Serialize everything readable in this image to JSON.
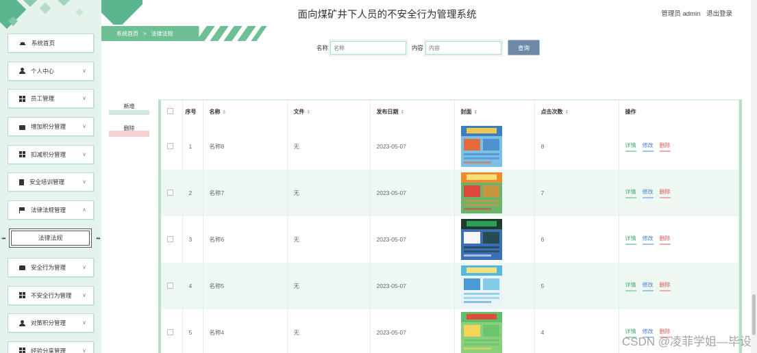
{
  "app": {
    "title": "面向煤矿井下人员的不安全行为管理系统",
    "user_label": "管理员 admin",
    "logout_label": "退出登录"
  },
  "breadcrumb": {
    "home": "系统首页",
    "sep": ">",
    "current": "法律法规"
  },
  "search": {
    "name_label": "名称",
    "name_placeholder": "名称",
    "content_label": "内容",
    "content_placeholder": "内容",
    "button_label": "查询"
  },
  "actions": {
    "add_label": "新增",
    "delete_label": "删除"
  },
  "sidebar": {
    "items": [
      {
        "label": "系统首页",
        "icon": "home-icon",
        "chevron": ""
      },
      {
        "label": "个人中心",
        "icon": "user-icon",
        "chevron": "∨"
      },
      {
        "label": "员工管理",
        "icon": "grid-icon",
        "chevron": "∨"
      },
      {
        "label": "增加积分管理",
        "icon": "briefcase-icon",
        "chevron": "∨"
      },
      {
        "label": "扣减积分管理",
        "icon": "grid-icon",
        "chevron": "∨"
      },
      {
        "label": "安全培训管理",
        "icon": "clipboard-icon",
        "chevron": "∨"
      },
      {
        "label": "法律法规管理",
        "icon": "flag-icon",
        "chevron": "∧"
      }
    ],
    "sub_item": {
      "label": "法律法规"
    },
    "items2": [
      {
        "label": "安全行为管理",
        "icon": "thumbs-up-icon",
        "chevron": "∨"
      },
      {
        "label": "不安全行为管理",
        "icon": "grid-icon",
        "chevron": "∨"
      },
      {
        "label": "对策积分管理",
        "icon": "user-icon",
        "chevron": "∨"
      },
      {
        "label": "经验分享管理",
        "icon": "grid-icon",
        "chevron": "∨"
      }
    ]
  },
  "table": {
    "headers": {
      "index": "序号",
      "name": "名称",
      "file": "文件",
      "date": "发布日期",
      "cover": "封面",
      "clicks": "点击次数",
      "ops": "操作"
    },
    "rows": [
      {
        "index": "1",
        "name": "名称8",
        "file": "无",
        "date": "2023-05-07",
        "clicks": "8"
      },
      {
        "index": "2",
        "name": "名称7",
        "file": "无",
        "date": "2023-05-07",
        "clicks": "7"
      },
      {
        "index": "3",
        "name": "名称6",
        "file": "无",
        "date": "2023-05-07",
        "clicks": "6"
      },
      {
        "index": "4",
        "name": "名称5",
        "file": "无",
        "date": "2023-05-07",
        "clicks": "5"
      },
      {
        "index": "5",
        "name": "名称4",
        "file": "无",
        "date": "2023-05-07",
        "clicks": "4"
      }
    ],
    "op_labels": {
      "detail": "详情",
      "edit": "修改",
      "delete": "删除"
    }
  },
  "watermark": "CSDN @凌菲学姐—毕设",
  "colors": {
    "accent": "#5bb58f",
    "sidebar_bg": "#e4f3ec",
    "search_button": "#6e89a6"
  }
}
